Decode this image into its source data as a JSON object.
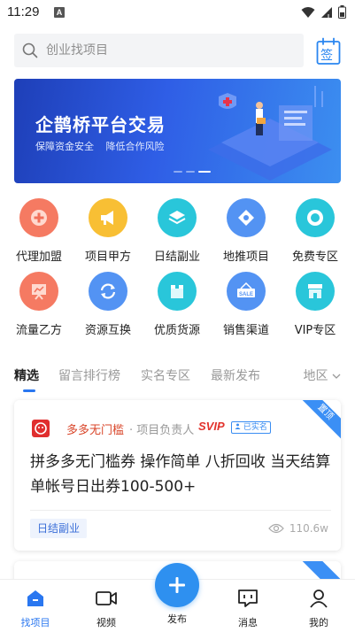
{
  "status_bar": {
    "time": "11:29",
    "notification_letter": "A"
  },
  "search": {
    "placeholder": "创业找项目"
  },
  "sign_button": {
    "label": "签"
  },
  "banner": {
    "title": "企鹊桥平台交易",
    "subtitle_items": [
      "保障资金安全",
      "降低合作风险"
    ],
    "page_count": 3,
    "active_page": 3
  },
  "categories": [
    {
      "label": "代理加盟",
      "icon": "plus-badge-icon",
      "color": "#f2705a"
    },
    {
      "label": "项目甲方",
      "icon": "megaphone-icon",
      "color": "#f5b92e"
    },
    {
      "label": "日结副业",
      "icon": "layers-icon",
      "color": "#22c3d6"
    },
    {
      "label": "地推项目",
      "icon": "puzzle-icon",
      "color": "#4d8ff2"
    },
    {
      "label": "免费专区",
      "icon": "free-badge-icon",
      "color": "#22c3d6"
    },
    {
      "label": "流量乙方",
      "icon": "presentation-board-icon",
      "color": "#f2705a"
    },
    {
      "label": "资源互换",
      "icon": "exchange-arrows-icon",
      "color": "#4d8ff2"
    },
    {
      "label": "优质货源",
      "icon": "package-box-icon",
      "color": "#22c3d6"
    },
    {
      "label": "销售渠道",
      "icon": "sale-sign-icon",
      "color": "#4d8ff2"
    },
    {
      "label": "VIP专区",
      "icon": "storefront-icon",
      "color": "#22c3d6"
    }
  ],
  "tabs": [
    {
      "label": "精选",
      "active": true
    },
    {
      "label": "留言排行榜",
      "active": false
    },
    {
      "label": "实名专区",
      "active": false
    },
    {
      "label": "最新发布",
      "active": false
    }
  ],
  "region_filter": {
    "label": "地区"
  },
  "listings": [
    {
      "ribbon": "置顶",
      "shop_name": "多多无门槛",
      "role": "· 项目负责人",
      "vip_badge": "SVIP",
      "verified_badge": "已实名",
      "title": "拼多多无门槛券 操作简单 八折回收 当天结算 单帐号日出券100-500+",
      "tag": "日结副业",
      "views": "110.6w"
    },
    {
      "ribbon": "置顶"
    }
  ],
  "bottom_nav": [
    {
      "label": "找项目",
      "icon": "home-icon",
      "active": true
    },
    {
      "label": "视频",
      "icon": "video-camera-icon",
      "active": false
    },
    {
      "label": "发布",
      "icon": "plus-icon",
      "active": false
    },
    {
      "label": "消息",
      "icon": "chat-bubble-icon",
      "active": false
    },
    {
      "label": "我的",
      "icon": "user-icon",
      "active": false
    }
  ],
  "colors": {
    "accent": "#2a77f0",
    "publish": "#2e90f0",
    "shop_name": "#d9462a",
    "svip": "#e2332d"
  }
}
